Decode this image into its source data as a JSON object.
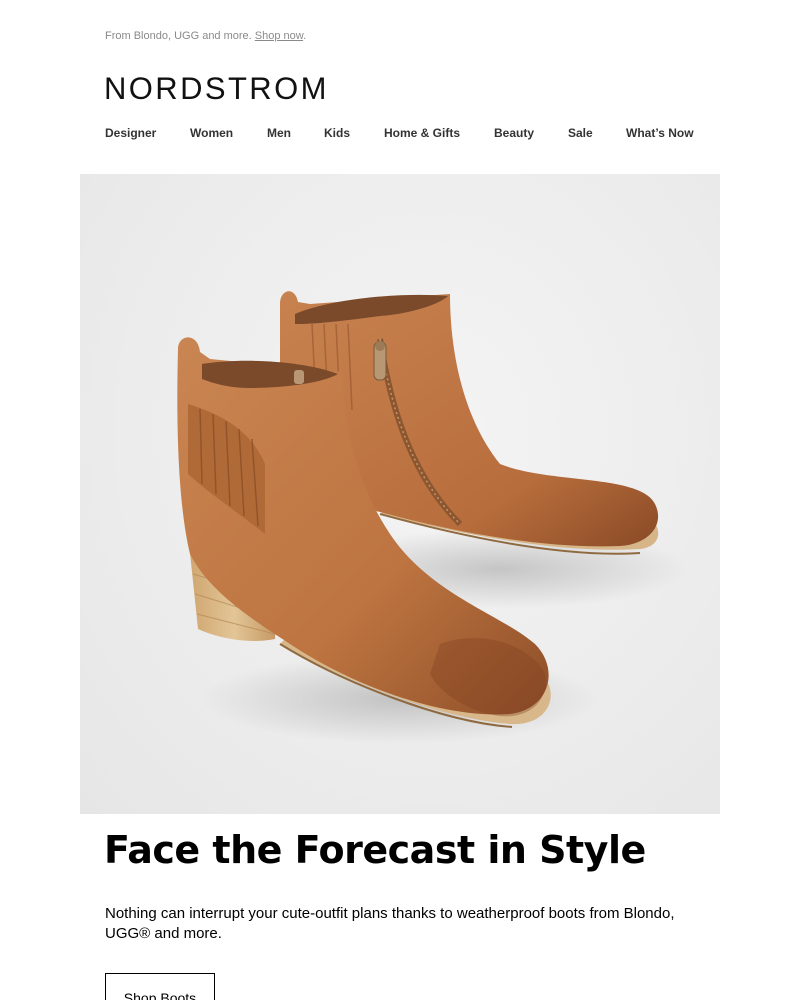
{
  "preheader": {
    "text": "From Blondo, UGG and more. ",
    "link": "Shop now",
    "suffix": "."
  },
  "brand": {
    "logo_text": "NORDSTROM"
  },
  "nav": {
    "items": [
      {
        "label": "Designer"
      },
      {
        "label": "Women"
      },
      {
        "label": "Men"
      },
      {
        "label": "Kids"
      },
      {
        "label": "Home & Gifts"
      },
      {
        "label": "Beauty"
      },
      {
        "label": "Sale"
      },
      {
        "label": "What’s Now"
      }
    ]
  },
  "hero": {
    "image_subject": "tan-leather-ankle-boots",
    "colors": {
      "leather": "#c07a45",
      "heel": "#d9b788",
      "background": "#efefef"
    }
  },
  "content": {
    "headline": "Face the Forecast in Style",
    "body": "Nothing can interrupt your cute-outfit plans thanks to weatherproof boots from Blondo, UGG® and more.",
    "cta_label": "Shop Boots"
  }
}
